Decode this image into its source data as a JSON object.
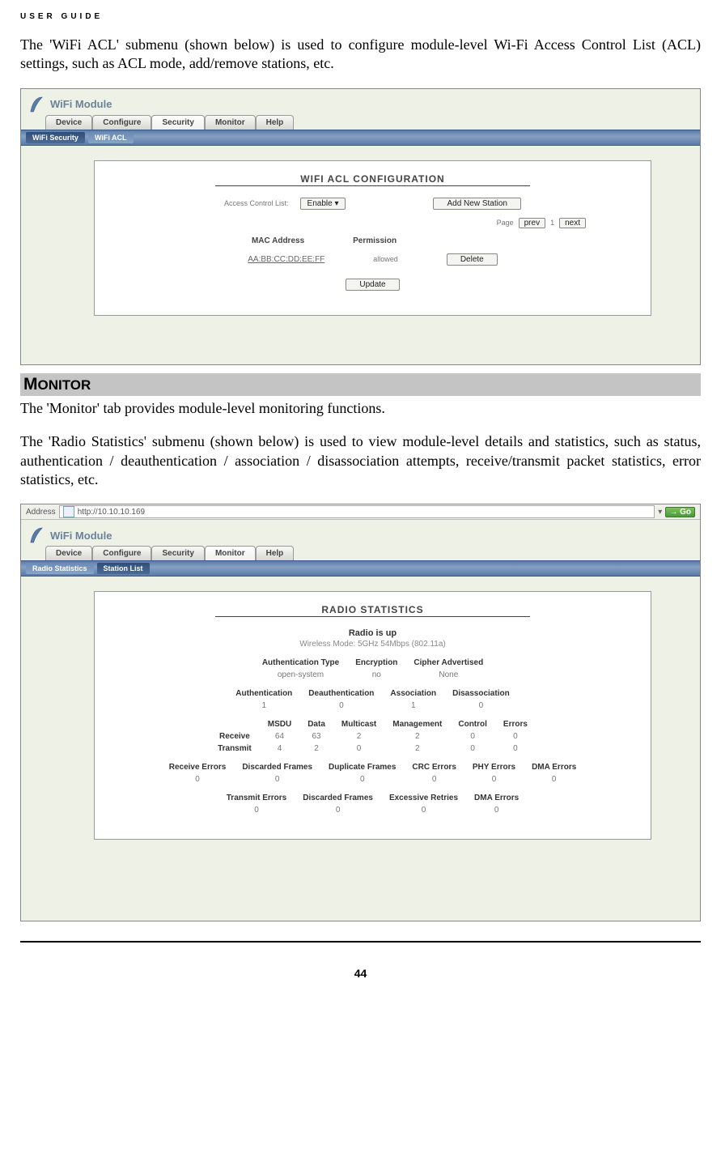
{
  "header": {
    "running": "USER GUIDE"
  },
  "para1": "The 'WiFi ACL' submenu (shown below) is used to configure module-level Wi-Fi Access Control List (ACL) settings, such as ACL mode, add/remove stations, etc.",
  "shot1": {
    "title": "WiFi Module",
    "tabs": [
      "Device",
      "Configure",
      "Security",
      "Monitor",
      "Help"
    ],
    "active_tab": 2,
    "subtabs": [
      "WiFi Security",
      "WiFi ACL"
    ],
    "active_subtab": 1,
    "panel_title": "WIFI ACL CONFIGURATION",
    "acl_label": "Access Control List:",
    "acl_value": "Enable",
    "add_btn": "Add New Station",
    "page_label": "Page",
    "prev": "prev",
    "page_num": "1",
    "next": "next",
    "col_mac": "MAC Address",
    "col_perm": "Permission",
    "mac": "AA:BB:CC:DD:EE:FF",
    "perm": "allowed",
    "delete": "Delete",
    "update": "Update"
  },
  "section": {
    "title_first": "M",
    "title_rest": "ONITOR"
  },
  "para2": "The 'Monitor' tab provides module-level monitoring functions.",
  "para3": "The 'Radio Statistics' submenu (shown below) is used to view module-level details and statistics, such as status, authentication / deauthentication / association / disassociation attempts, receive/transmit packet statistics, error statistics, etc.",
  "shot2": {
    "address_label": "Address",
    "url": "http://10.10.10.169",
    "go": "Go",
    "title": "WiFi Module",
    "tabs": [
      "Device",
      "Configure",
      "Security",
      "Monitor",
      "Help"
    ],
    "active_tab": 3,
    "subtabs": [
      "Radio Statistics",
      "Station List"
    ],
    "active_subtab": 0,
    "panel_title": "RADIO STATISTICS",
    "radio_status": "Radio is  up",
    "wireless_mode": "Wireless Mode: 5GHz 54Mbps (802.11a)",
    "t1_headers": [
      "Authentication Type",
      "Encryption",
      "Cipher Advertised"
    ],
    "t1_values": [
      "open-system",
      "no",
      "None"
    ],
    "t2_headers": [
      "Authentication",
      "Deauthentication",
      "Association",
      "Disassociation"
    ],
    "t2_values": [
      "1",
      "0",
      "1",
      "0"
    ],
    "t3_headers": [
      "",
      "MSDU",
      "Data",
      "Multicast",
      "Management",
      "Control",
      "Errors"
    ],
    "t3_row1_label": "Receive",
    "t3_row1": [
      "64",
      "63",
      "2",
      "2",
      "0",
      "0"
    ],
    "t3_row2_label": "Transmit",
    "t3_row2": [
      "4",
      "2",
      "0",
      "2",
      "0",
      "0"
    ],
    "t4_headers": [
      "Receive Errors",
      "Discarded Frames",
      "Duplicate Frames",
      "CRC Errors",
      "PHY Errors",
      "DMA Errors"
    ],
    "t4_values": [
      "0",
      "0",
      "0",
      "0",
      "0",
      "0"
    ],
    "t5_headers": [
      "Transmit Errors",
      "Discarded Frames",
      "Excessive Retries",
      "DMA Errors"
    ],
    "t5_values": [
      "0",
      "0",
      "0",
      "0"
    ]
  },
  "page_number": "44"
}
